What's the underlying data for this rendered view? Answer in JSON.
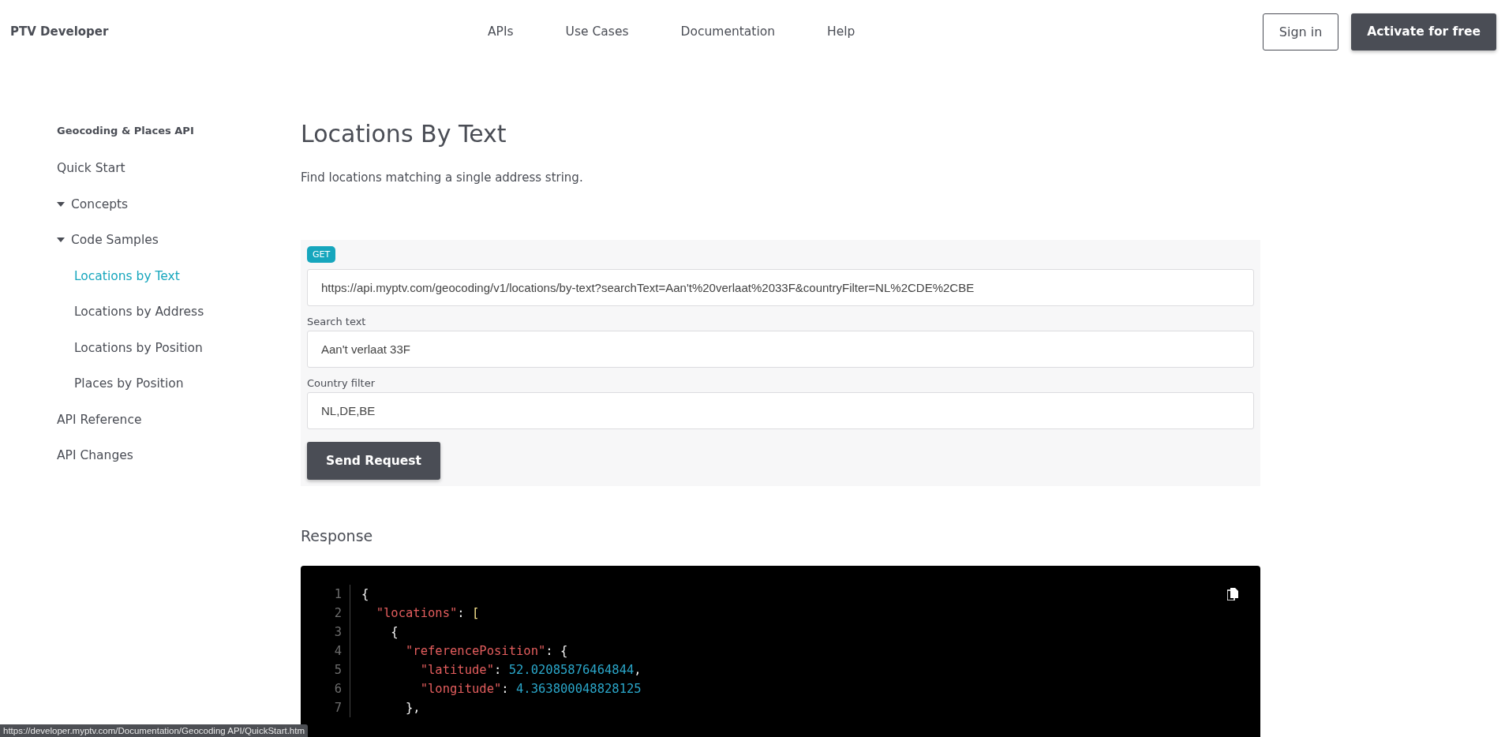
{
  "header": {
    "logo": "PTV Developer",
    "nav": [
      "APIs",
      "Use Cases",
      "Documentation",
      "Help"
    ],
    "sign_in": "Sign in",
    "activate": "Activate for free"
  },
  "sidebar": {
    "title": "Geocoding & Places API",
    "items": [
      {
        "label": "Quick Start",
        "selected": false
      },
      {
        "label": "Concepts",
        "selected": false,
        "expanded": true
      },
      {
        "label": "Code Samples",
        "selected": false,
        "expanded": true,
        "children": [
          {
            "label": "Locations by Text",
            "selected": true
          },
          {
            "label": "Locations by Address",
            "selected": false
          },
          {
            "label": "Locations by Position",
            "selected": false
          },
          {
            "label": "Places by Position",
            "selected": false
          }
        ]
      },
      {
        "label": "API Reference",
        "selected": false
      },
      {
        "label": "API Changes",
        "selected": false
      }
    ]
  },
  "page": {
    "title": "Locations By Text",
    "description": "Find locations matching a single address string."
  },
  "request": {
    "method": "GET",
    "url": "https://api.myptv.com/geocoding/v1/locations/by-text?searchText=Aan't%20verlaat%2033F&countryFilter=NL%2CDE%2CBE",
    "fields": [
      {
        "label": "Search text",
        "value": "Aan't verlaat 33F"
      },
      {
        "label": "Country filter",
        "value": "NL,DE,BE"
      }
    ],
    "button": "Send Request"
  },
  "response": {
    "title": "Response",
    "lines": [
      {
        "number": "1",
        "tokens": [
          {
            "kind": "punct",
            "text": "{"
          }
        ]
      },
      {
        "number": "2",
        "tokens": [
          {
            "kind": "key",
            "text": "  \"locations\""
          },
          {
            "kind": "punct",
            "text": ": "
          },
          {
            "kind": "bracket",
            "text": "["
          }
        ]
      },
      {
        "number": "3",
        "tokens": [
          {
            "kind": "punct",
            "text": "    {"
          }
        ]
      },
      {
        "number": "4",
        "tokens": [
          {
            "kind": "key",
            "text": "      \"referencePosition\""
          },
          {
            "kind": "punct",
            "text": ": {"
          }
        ]
      },
      {
        "number": "5",
        "tokens": [
          {
            "kind": "key",
            "text": "        \"latitude\""
          },
          {
            "kind": "punct",
            "text": ": "
          },
          {
            "kind": "number",
            "text": "52.02085876464844"
          },
          {
            "kind": "punct",
            "text": ","
          }
        ]
      },
      {
        "number": "6",
        "tokens": [
          {
            "kind": "key",
            "text": "        \"longitude\""
          },
          {
            "kind": "punct",
            "text": ": "
          },
          {
            "kind": "number",
            "text": "4.363800048828125"
          }
        ]
      },
      {
        "number": "7",
        "tokens": [
          {
            "kind": "punct",
            "text": "      },"
          }
        ]
      }
    ]
  },
  "status_bar": "https://developer.myptv.com/Documentation/Geocoding API/QuickStart.htm"
}
